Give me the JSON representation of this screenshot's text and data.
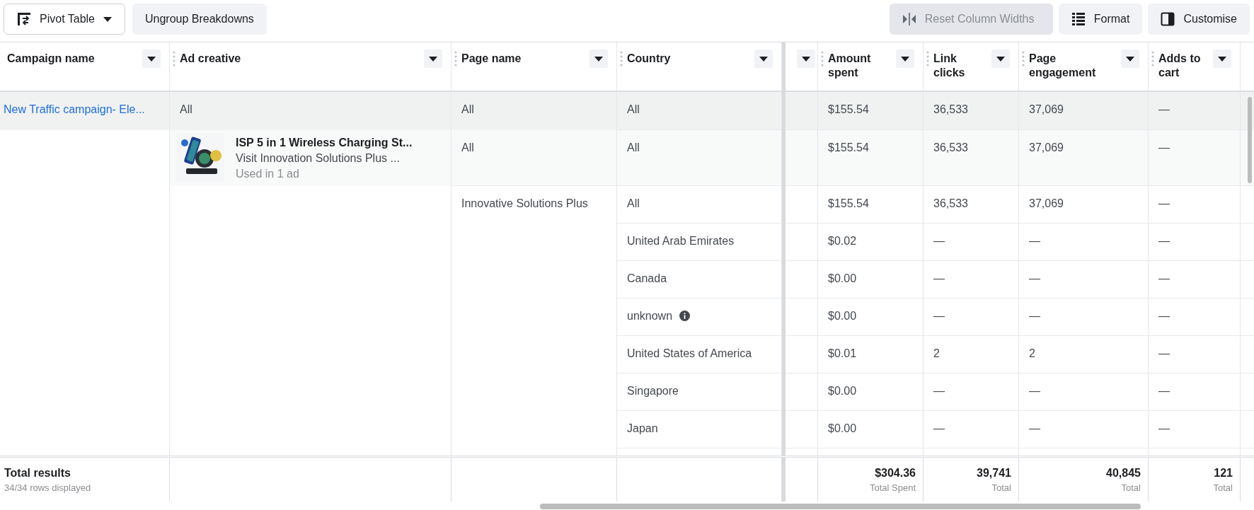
{
  "toolbar": {
    "view_menu": "Pivot Table",
    "ungroup": "Ungroup Breakdowns",
    "reset": {
      "label": "Reset Column Widths",
      "disabled": true
    },
    "format": "Format",
    "customise": "Customise"
  },
  "columns": [
    {
      "label": "Campaign name"
    },
    {
      "label": "Ad creative"
    },
    {
      "label": "Page name"
    },
    {
      "label": "Country"
    },
    {
      "kind": "unlabeled"
    },
    {
      "label": "Amount spent"
    },
    {
      "label": "Link clicks"
    },
    {
      "label": "Page engagement"
    },
    {
      "label": "Adds to cart"
    }
  ],
  "campaign": {
    "name": "New Traffic campaign- Ele..."
  },
  "summary_row": {
    "ad_creative": "All",
    "page_name": "All",
    "country": "All",
    "metrics": [
      "$155.54",
      "36,533",
      "37,069",
      "—"
    ]
  },
  "creative_row": {
    "creative": {
      "title": "ISP 5 in 1 Wireless Charging St...",
      "subtitle": "Visit Innovation Solutions Plus ...",
      "usage": "Used in 1 ad"
    },
    "page_name": "All",
    "country": "All",
    "metrics": [
      "$155.54",
      "36,533",
      "37,069",
      "—"
    ]
  },
  "page_group": {
    "page_name": "Innovative Solutions Plus",
    "rows": [
      {
        "country": "All",
        "info": false,
        "metrics": [
          "$155.54",
          "36,533",
          "37,069",
          "—"
        ]
      },
      {
        "country": "United Arab Emirates",
        "info": false,
        "metrics": [
          "$0.02",
          "—",
          "—",
          "—"
        ]
      },
      {
        "country": "Canada",
        "info": false,
        "metrics": [
          "$0.00",
          "—",
          "—",
          "—"
        ]
      },
      {
        "country": "unknown",
        "info": true,
        "metrics": [
          "$0.00",
          "—",
          "—",
          "—"
        ]
      },
      {
        "country": "United States of America",
        "info": false,
        "metrics": [
          "$0.01",
          "2",
          "2",
          "—"
        ]
      },
      {
        "country": "Singapore",
        "info": false,
        "metrics": [
          "$0.00",
          "—",
          "—",
          "—"
        ]
      },
      {
        "country": "Japan",
        "info": false,
        "metrics": [
          "$0.00",
          "—",
          "—",
          "—"
        ]
      }
    ]
  },
  "totals": {
    "label": "Total results",
    "rows_displayed": "34/34 rows displayed",
    "cells": [
      {
        "value": "$304.36",
        "caption": "Total Spent"
      },
      {
        "value": "39,741",
        "caption": "Total"
      },
      {
        "value": "40,845",
        "caption": "Total"
      },
      {
        "value": "121",
        "caption": "Total"
      }
    ]
  }
}
